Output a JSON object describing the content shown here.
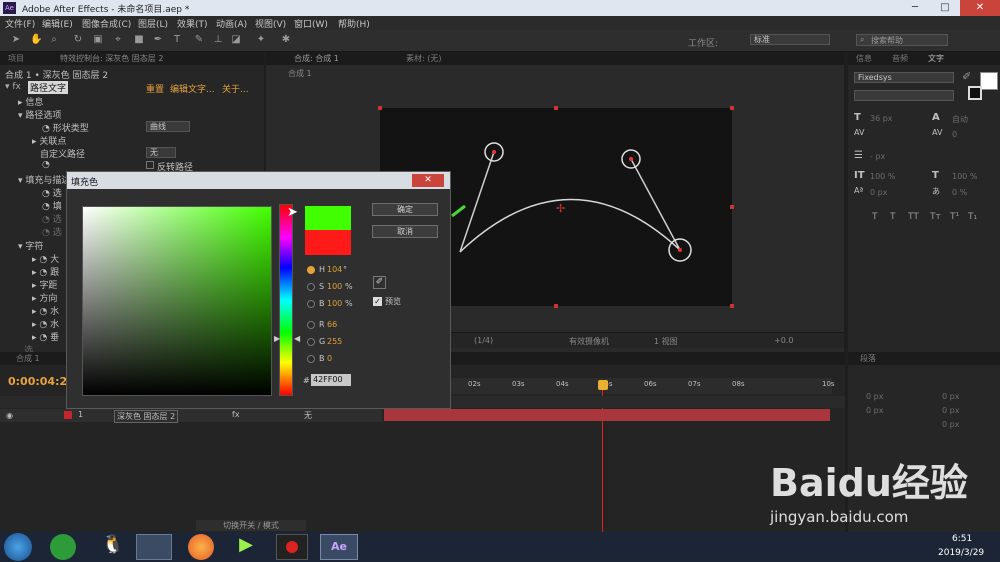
{
  "window": {
    "title": "Adobe After Effects - 未命名项目.aep *",
    "app_icon": "Ae"
  },
  "menu": [
    "文件(F)",
    "编辑(E)",
    "图像合成(C)",
    "图层(L)",
    "效果(T)",
    "动画(A)",
    "视图(V)",
    "窗口(W)",
    "帮助(H)"
  ],
  "toolbar": {
    "workspace_label": "工作区:",
    "workspace_value": "标准",
    "search_placeholder": "搜索帮助"
  },
  "project_tabs": [
    "项目",
    "特效控制台: 深灰色 固态层 2"
  ],
  "effects": {
    "header": "合成 1 • 深灰色 固态层 2",
    "effect_name": "路径文字",
    "links": [
      "重置",
      "编辑文字...",
      "关于..."
    ],
    "rows": [
      {
        "label": "信息"
      },
      {
        "label": "路径选项"
      },
      {
        "label": "形状类型",
        "value": "曲线"
      },
      {
        "label": "关联点"
      },
      {
        "label": "自定义路径",
        "value": "无"
      },
      {
        "label": "反转路径"
      },
      {
        "label": "填充与描边"
      },
      {
        "label": "字符"
      },
      {
        "label": "大"
      },
      {
        "label": "跟"
      },
      {
        "label": "字距"
      },
      {
        "label": "方向"
      },
      {
        "label": "水"
      },
      {
        "label": "水"
      },
      {
        "label": "垂"
      },
      {
        "label": "选"
      }
    ],
    "partial": [
      "选",
      "填",
      "选",
      "选"
    ]
  },
  "comp": {
    "tabs": [
      "合成: 合成 1",
      "素材: (无)"
    ],
    "crumb": "合成 1",
    "footer": {
      "fraction": "(1/4)",
      "camera": "有效摄像机",
      "views": "1 视图",
      "exposure": "+0.0"
    }
  },
  "right_panel": {
    "tabs": [
      "信息",
      "音频",
      "文字"
    ],
    "font": "Fixedsys",
    "size": "36 px",
    "leading": "自动",
    "tracking": "0",
    "indent": "- px",
    "vscale": "100 %",
    "hscale": "100 %",
    "baseline": "0 px",
    "tsume": "0 %",
    "styles": [
      "T",
      "T",
      "TT",
      "Tт",
      "T¹",
      "T₁"
    ]
  },
  "paragraph": {
    "tab": "段落",
    "values": [
      "0 px",
      "0 px",
      "0 px",
      "0 px",
      "0 px"
    ]
  },
  "timeline": {
    "tab": "合成 1",
    "time": "0:00:04:2",
    "ticks": [
      "02s",
      "03s",
      "04s",
      "05s",
      "06s",
      "07s",
      "08s",
      "10s"
    ],
    "layer_num": "1",
    "layer_name": "深灰色 固态层 2",
    "parent": "无",
    "footer": "切换开关 / 模式"
  },
  "color_dialog": {
    "title": "填充色",
    "ok": "确定",
    "cancel": "取消",
    "H": {
      "label": "H",
      "value": "104",
      "unit": "°"
    },
    "S": {
      "label": "S",
      "value": "100",
      "unit": "%"
    },
    "B": {
      "label": "B",
      "value": "100",
      "unit": "%"
    },
    "R": {
      "label": "R",
      "value": "66"
    },
    "G": {
      "label": "G",
      "value": "255"
    },
    "Bl": {
      "label": "B",
      "value": "0"
    },
    "hex_label": "#",
    "hex": "42FF00",
    "preview_label": "预览",
    "new_color": "#42ff00",
    "old_color": "#ff1a1a"
  },
  "taskbar": {
    "time": "6:51",
    "date": "2019/3/29"
  },
  "watermark": {
    "brand": "Baidu经验",
    "url": "jingyan.baidu.com"
  }
}
